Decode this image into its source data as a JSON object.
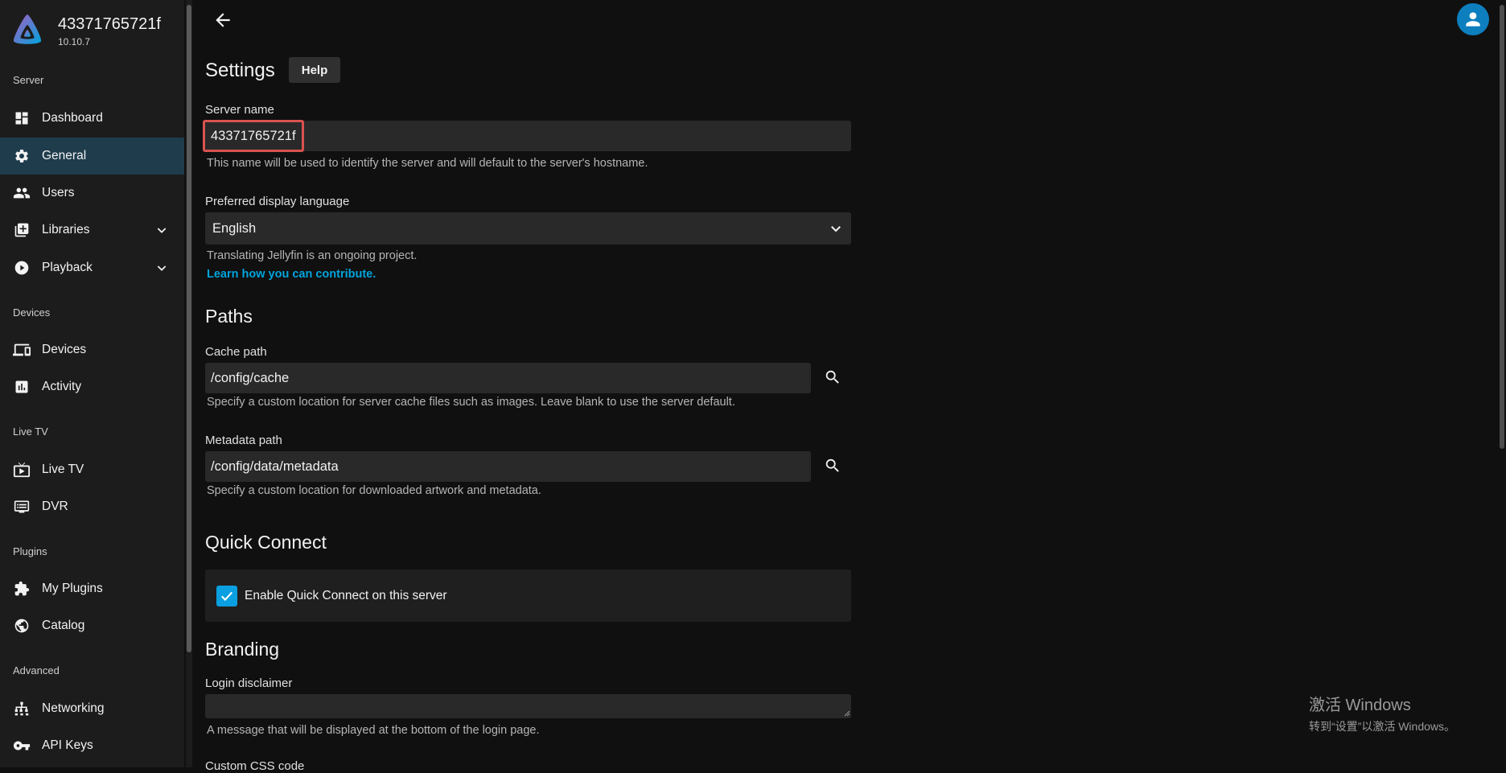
{
  "sidebar": {
    "server_name": "43371765721f",
    "version": "10.10.7",
    "sections": {
      "server": "Server",
      "devices": "Devices",
      "live_tv": "Live TV",
      "plugins": "Plugins",
      "advanced": "Advanced"
    },
    "items": {
      "dashboard": "Dashboard",
      "general": "General",
      "users": "Users",
      "libraries": "Libraries",
      "playback": "Playback",
      "devices": "Devices",
      "activity": "Activity",
      "live_tv": "Live TV",
      "dvr": "DVR",
      "my_plugins": "My Plugins",
      "catalog": "Catalog",
      "networking": "Networking",
      "api_keys": "API Keys"
    },
    "active_item": "General"
  },
  "page": {
    "title": "Settings",
    "help_label": "Help"
  },
  "server_name": {
    "label": "Server name",
    "value": "43371765721f",
    "hint": "This name will be used to identify the server and will default to the server's hostname."
  },
  "language": {
    "label": "Preferred display language",
    "value": "English",
    "hint": "Translating Jellyfin is an ongoing project.",
    "link": "Learn how you can contribute."
  },
  "paths": {
    "title": "Paths",
    "cache_label": "Cache path",
    "cache_value": "/config/cache",
    "cache_hint": "Specify a custom location for server cache files such as images. Leave blank to use the server default.",
    "metadata_label": "Metadata path",
    "metadata_value": "/config/data/metadata",
    "metadata_hint": "Specify a custom location for downloaded artwork and metadata."
  },
  "quick_connect": {
    "title": "Quick Connect",
    "checkbox_label": "Enable Quick Connect on this server",
    "checked": true
  },
  "branding": {
    "title": "Branding",
    "login_disclaimer_label": "Login disclaimer",
    "login_disclaimer_value": "",
    "login_disclaimer_hint": "A message that will be displayed at the bottom of the login page.",
    "custom_css_label": "Custom CSS code"
  },
  "watermark": {
    "line1": "激活 Windows",
    "line2": "转到“设置”以激活 Windows。"
  },
  "colors": {
    "accent": "#00a4dc",
    "active_nav": "#1f3c4d",
    "highlight_border": "#d9534f",
    "checkbox": "#0a9fe0"
  },
  "icons": {
    "back": "arrow-left-icon",
    "user": "account-circle-icon",
    "search": "search-icon"
  }
}
